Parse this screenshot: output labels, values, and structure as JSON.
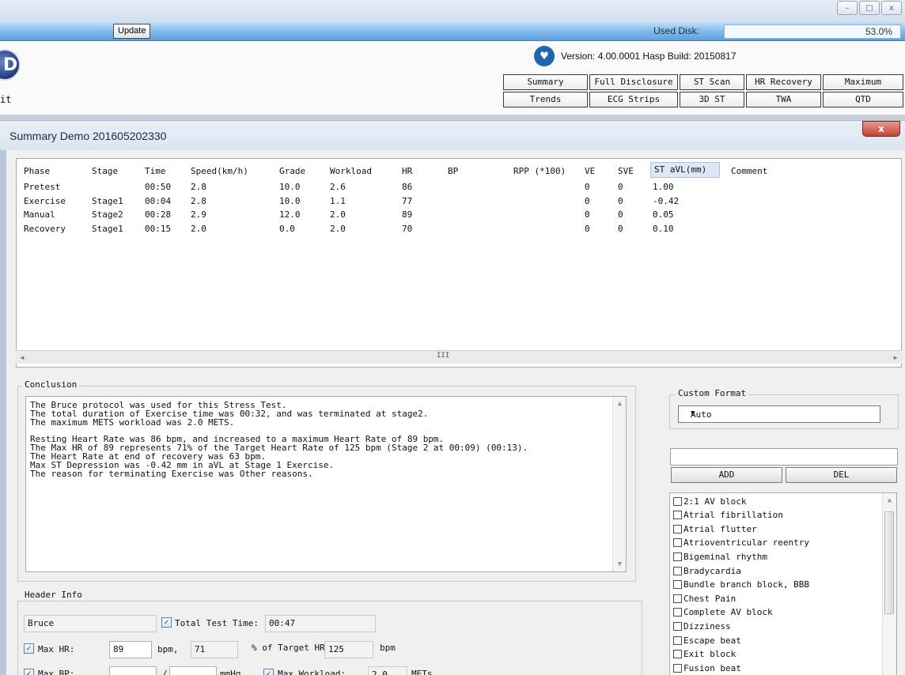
{
  "toolbar": {
    "update_label": "Update",
    "used_disk_label": "Used Disk:",
    "used_disk_pct": "53.0%",
    "used_disk_fraction": 0.53
  },
  "app": {
    "logo_letter": "D",
    "left_label": "it",
    "version_text": "Version:  4.00.0001 Hasp    Build:  20150817"
  },
  "nav": {
    "row1": [
      "Summary",
      "Full Disclosure",
      "ST Scan",
      "HR Recovery",
      "Maximum"
    ],
    "row2": [
      "Trends",
      "ECG Strips",
      "3D ST",
      "TWA",
      "QTD"
    ]
  },
  "dialog": {
    "title": "Summary  Demo  201605202330",
    "close_label": "x"
  },
  "table": {
    "headers": [
      "Phase",
      "Stage",
      "Time",
      "Speed(km/h)",
      "Grade",
      "Workload",
      "HR",
      "BP",
      "RPP (*100)",
      "VE",
      "SVE",
      "ST aVL(mm)",
      "Comment"
    ],
    "rows": [
      [
        "Pretest",
        "",
        "00:50",
        "2.8",
        "10.0",
        "2.6",
        "86",
        "",
        "",
        "0",
        "0",
        "1.00",
        ""
      ],
      [
        "Exercise",
        "Stage1",
        "00:04",
        "2.8",
        "10.0",
        "1.1",
        "77",
        "",
        "",
        "0",
        "0",
        "-0.42",
        ""
      ],
      [
        "Manual",
        "Stage2",
        "00:28",
        "2.9",
        "12.0",
        "2.0",
        "89",
        "",
        "",
        "0",
        "0",
        "0.05",
        ""
      ],
      [
        "Recovery",
        "Stage1",
        "00:15",
        "2.0",
        "0.0",
        "2.0",
        "70",
        "",
        "",
        "0",
        "0",
        "0.10",
        ""
      ]
    ],
    "scroll_left": "◂",
    "scroll_right": "▸",
    "scroll_thumb": "III"
  },
  "conclusion": {
    "title": "Conclusion",
    "lines": [
      "The Bruce protocol was used for this Stress Test.",
      "The total duration of Exercise time was 00:32, and was terminated at stage2.",
      "The maximum METS workload was 2.0 METS.",
      "",
      "Resting Heart Rate was 86 bpm, and increased to a maximum Heart Rate of 89 bpm.",
      "The Max HR of 89 represents 71% of the Target Heart Rate of 125 bpm  (Stage 2 at 00:09) (00:13).",
      "The Heart Rate at end of recovery was 63 bpm.",
      "Max ST Depression was -0.42 mm in aVL at Stage 1 Exercise.",
      "The reason for terminating Exercise was Other reasons."
    ]
  },
  "custom_format": {
    "title": "Custom Format",
    "selected": "Auto",
    "add_label": "ADD",
    "del_label": "DEL",
    "input_value": ""
  },
  "reasons": [
    "2:1 AV block",
    "Atrial fibrillation",
    "Atrial flutter",
    "Atrioventricular reentry",
    "Bigeminal rhythm",
    "Bradycardia",
    "Bundle branch block, BBB",
    "Chest Pain",
    "Complete AV block",
    "Dizziness",
    "Escape beat",
    "Exit block",
    "Fusion beat"
  ],
  "header_info": {
    "title": "Header Info",
    "protocol": "Bruce",
    "total_test_time_label": "Total Test Time:",
    "total_test_time": "00:47",
    "max_hr_label": "Max HR:",
    "max_hr": "89",
    "bpm_label": "bpm,",
    "pct": "71",
    "pct_target_label": "% of Target HR",
    "target_hr": "125",
    "bpm2_label": "bpm",
    "max_bp_label": "Max BP:",
    "bp_sep": "/",
    "mmhg_label": "mmHg",
    "max_workload_label": "Max Workload:",
    "max_workload": "2.0",
    "mets_label": "METs"
  },
  "colors": {
    "title_bar": "#7db7ea",
    "close_button": "#c5432f",
    "selected_header": "#dce8f6"
  },
  "icons": {
    "heart": "heart-icon",
    "logo": "app-logo",
    "dropdown": "chevron-down-icon",
    "check": "check-icon"
  }
}
